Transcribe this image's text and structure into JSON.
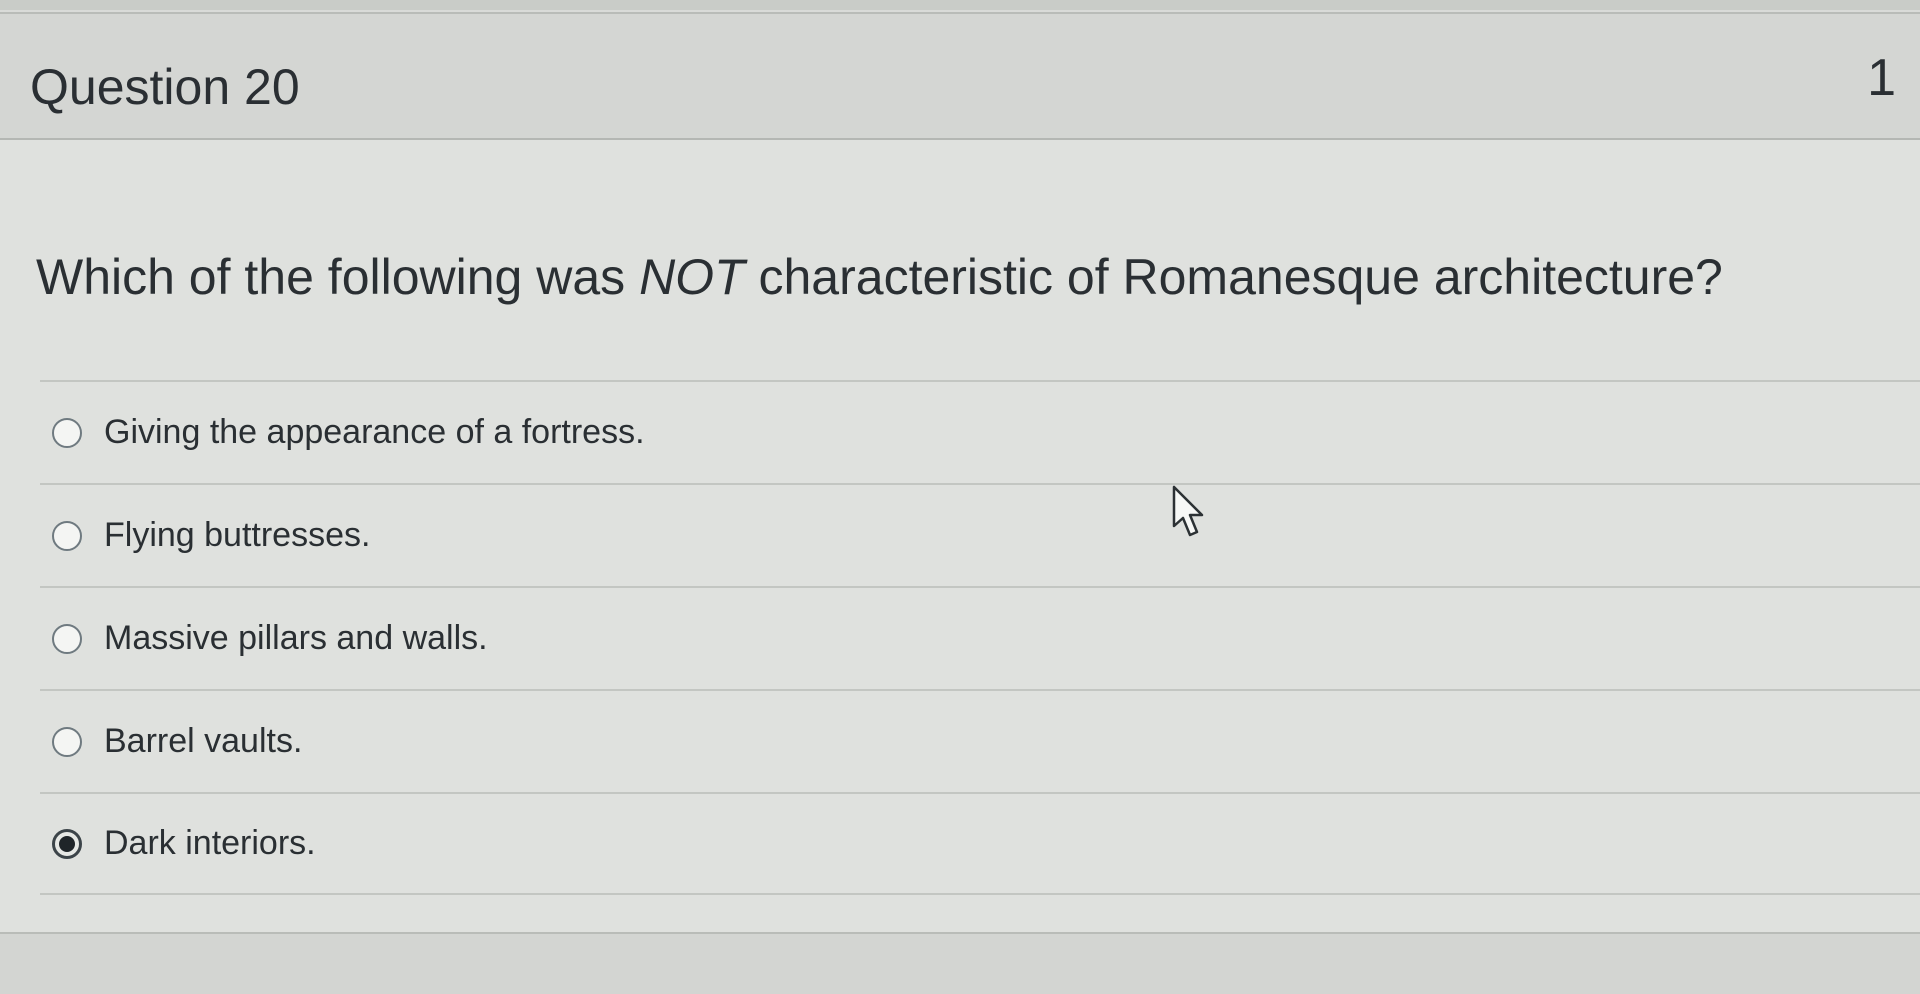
{
  "question": {
    "title": "Question 20",
    "points": "1",
    "text_before": "Which of the following was ",
    "text_emphasis": "NOT",
    "text_after": " characteristic of Romanesque architecture?",
    "answers": [
      {
        "label": "Giving the appearance of a fortress.",
        "selected": false
      },
      {
        "label": "Flying buttresses.",
        "selected": false
      },
      {
        "label": "Massive pillars and walls.",
        "selected": false
      },
      {
        "label": "Barrel vaults.",
        "selected": false
      },
      {
        "label": "Dark interiors.",
        "selected": true
      }
    ]
  },
  "icons": {
    "cursor": "mouse-pointer-icon",
    "unselected": "radio-unchecked-icon",
    "selected": "radio-checked-icon"
  },
  "colors": {
    "background": "#dfe1de",
    "header": "#d4d6d3",
    "text": "#2a2f33"
  }
}
